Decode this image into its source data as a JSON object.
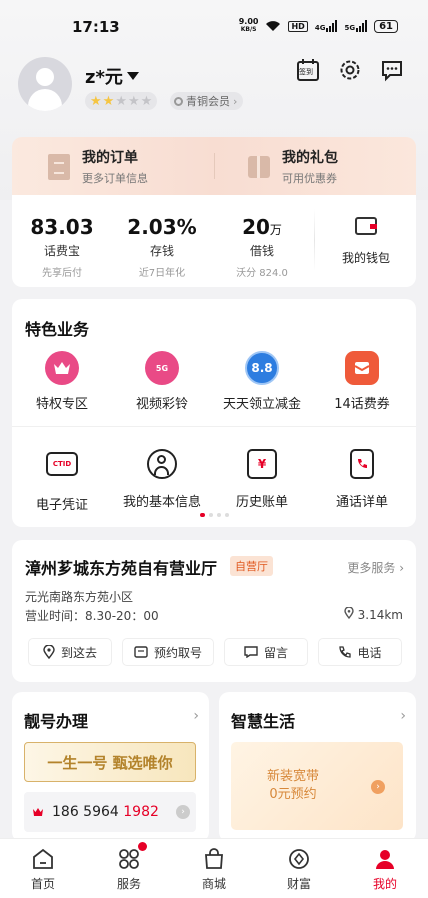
{
  "status_bar": {
    "time": "17:13",
    "speed_value": "9.00",
    "speed_unit": "KB/S",
    "hd_label": "HD",
    "net1": "4G",
    "net2": "5G",
    "battery": "61"
  },
  "profile": {
    "name": "z*元",
    "stars_on": 2,
    "stars_total": 5,
    "level_label": "青铜会员"
  },
  "header_icons": {
    "checkin_label": "签到"
  },
  "banner": {
    "orders_title": "我的订单",
    "orders_sub": "更多订单信息",
    "gifts_title": "我的礼包",
    "gifts_sub": "可用优惠券"
  },
  "assets": [
    {
      "value": "83.03",
      "unit": "",
      "label": "话费宝",
      "sub": "先享后付"
    },
    {
      "value": "2.03%",
      "unit": "",
      "label": "存钱",
      "sub": "近7日年化"
    },
    {
      "value": "20",
      "unit": "万",
      "label": "借钱",
      "sub": "沃分 824.0"
    }
  ],
  "wallet_label": "我的钱包",
  "services": {
    "title": "特色业务",
    "row1": [
      {
        "label": "特权专区",
        "icon": "crown-icon",
        "color": "#e94a86"
      },
      {
        "label": "视频彩铃",
        "icon": "bell-icon",
        "color": "#e94a86",
        "glyph": "5G"
      },
      {
        "label": "天天领立减金",
        "icon": "coin-icon",
        "color": "#2d7de0",
        "glyph": "8.8"
      },
      {
        "label": "14话费券",
        "icon": "voucher-icon",
        "color": "#ef5a3a"
      }
    ],
    "row2": [
      {
        "label": "电子凭证",
        "icon": "id-card-icon",
        "glyph": "CTID"
      },
      {
        "label": "我的基本信息",
        "icon": "user-info-icon",
        "glyph": ""
      },
      {
        "label": "历史账单",
        "icon": "bill-icon",
        "glyph": "¥"
      },
      {
        "label": "通话详单",
        "icon": "call-record-icon",
        "glyph": ""
      }
    ],
    "page_count": 4,
    "page_active": 0
  },
  "store": {
    "name": "漳州芗城东方苑自有营业厅",
    "tag": "自营厅",
    "more": "更多服务",
    "address": "元光南路东方苑小区",
    "hours": "营业时间：8.30-20：00",
    "distance": "3.14km",
    "buttons": [
      "到这去",
      "预约取号",
      "留言",
      "电话"
    ]
  },
  "number_card": {
    "title": "靓号办理",
    "slogan": "一生一号  甄选唯你",
    "number_prefix": "186 5964 ",
    "number_highlight": "1982"
  },
  "life_card": {
    "title": "智慧生活",
    "promo_line1": "新装宽带",
    "promo_line2": "0元预约"
  },
  "tabbar": [
    {
      "label": "首页",
      "icon": "home-icon",
      "active": false
    },
    {
      "label": "服务",
      "icon": "services-icon",
      "active": false,
      "dot": true
    },
    {
      "label": "商城",
      "icon": "shop-bag-icon",
      "active": false
    },
    {
      "label": "财富",
      "icon": "wealth-icon",
      "active": false
    },
    {
      "label": "我的",
      "icon": "profile-icon",
      "active": true
    }
  ],
  "colors": {
    "accent": "#e60027",
    "store_tag": "#e0581f",
    "gold": "#b3832b"
  }
}
